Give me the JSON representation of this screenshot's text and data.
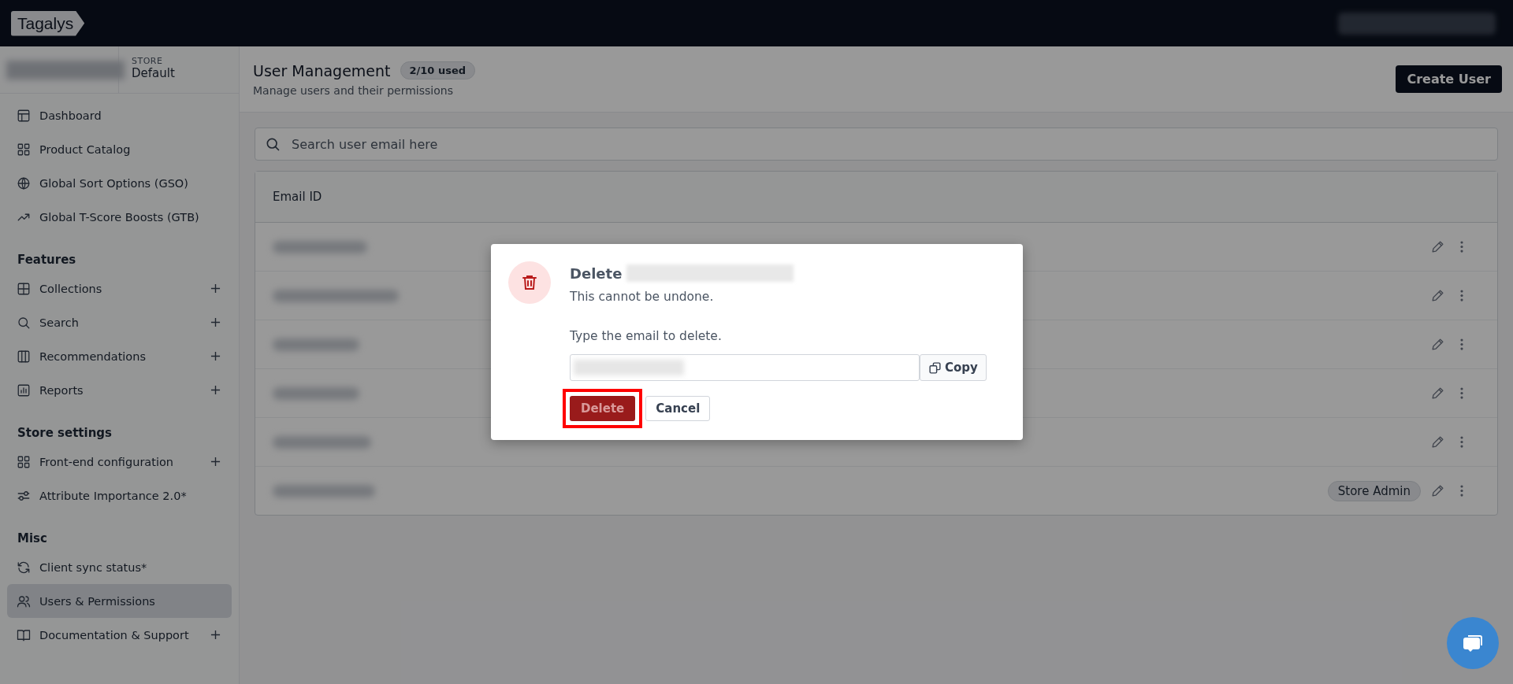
{
  "topbar": {
    "logo": "Tagalys"
  },
  "store": {
    "label": "STORE",
    "value": "Default"
  },
  "sidebar": {
    "sections": [
      {
        "items": [
          {
            "label": "Dashboard",
            "expandable": false,
            "selected": false
          },
          {
            "label": "Product Catalog",
            "expandable": false,
            "selected": false
          },
          {
            "label": "Global Sort Options (GSO)",
            "expandable": false,
            "selected": false
          },
          {
            "label": "Global T-Score Boosts (GTB)",
            "expandable": false,
            "selected": false
          }
        ]
      },
      {
        "heading": "Features",
        "items": [
          {
            "label": "Collections",
            "expandable": true,
            "selected": false
          },
          {
            "label": "Search",
            "expandable": true,
            "selected": false
          },
          {
            "label": "Recommendations",
            "expandable": true,
            "selected": false
          },
          {
            "label": "Reports",
            "expandable": true,
            "selected": false
          }
        ]
      },
      {
        "heading": "Store settings",
        "items": [
          {
            "label": "Front-end configuration",
            "expandable": true,
            "selected": false
          },
          {
            "label": "Attribute Importance 2.0*",
            "expandable": false,
            "selected": false
          }
        ]
      },
      {
        "heading": "Misc",
        "items": [
          {
            "label": "Client sync status*",
            "expandable": false,
            "selected": false
          },
          {
            "label": "Users & Permissions",
            "expandable": false,
            "selected": true
          },
          {
            "label": "Documentation & Support",
            "expandable": true,
            "selected": false
          }
        ]
      }
    ]
  },
  "page": {
    "title": "User Management",
    "usage_badge": "2/10 used",
    "subtitle": "Manage users and their permissions",
    "create_button": "Create User"
  },
  "search": {
    "placeholder": "Search user email here"
  },
  "table": {
    "columns": [
      "Email ID"
    ],
    "rows": [
      {},
      {},
      {},
      {},
      {},
      {
        "role_badge": "Store Admin"
      }
    ]
  },
  "dialog": {
    "title": "Delete",
    "message": "This cannot be undone.",
    "prompt": "Type the email to delete.",
    "copy_button": "Copy",
    "delete_button": {
      "label": "Delete",
      "disabled": true,
      "highlighted": true
    },
    "cancel_button": "Cancel"
  }
}
